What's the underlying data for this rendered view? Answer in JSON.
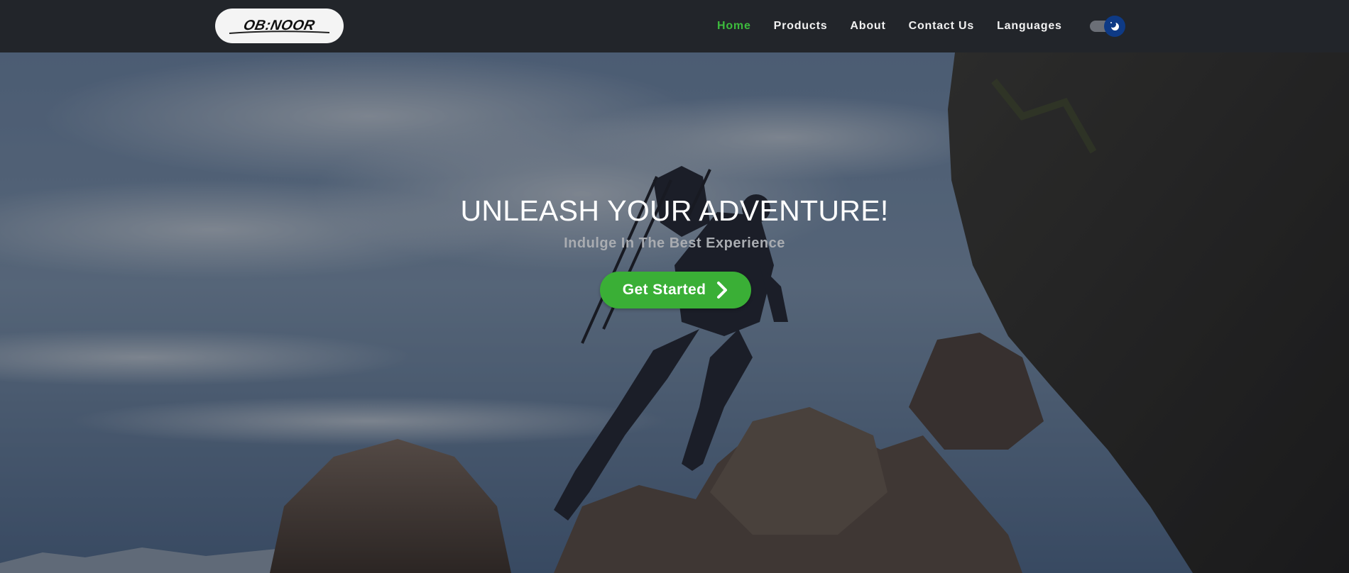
{
  "brand": {
    "logo_text": "OB:NOOR"
  },
  "nav": {
    "items": [
      {
        "label": "Home",
        "active": true
      },
      {
        "label": "Products",
        "active": false
      },
      {
        "label": "About",
        "active": false
      },
      {
        "label": "Contact Us",
        "active": false
      },
      {
        "label": "Languages",
        "active": false
      }
    ],
    "theme_toggle": {
      "state": "dark",
      "icon": "moon-icon"
    }
  },
  "hero": {
    "title": "UNLEASH YOUR ADVENTURE!",
    "subtitle": "Indulge In The Best Experience",
    "cta_label": "Get Started",
    "cta_icon": "chevron-right-icon",
    "background": "hiker-climbing-rocks-photo"
  },
  "colors": {
    "accent": "#3aaf36",
    "nav_active": "#3dbb3d",
    "navbar_bg": "#22252a",
    "toggle_knob": "#0e3a85"
  }
}
